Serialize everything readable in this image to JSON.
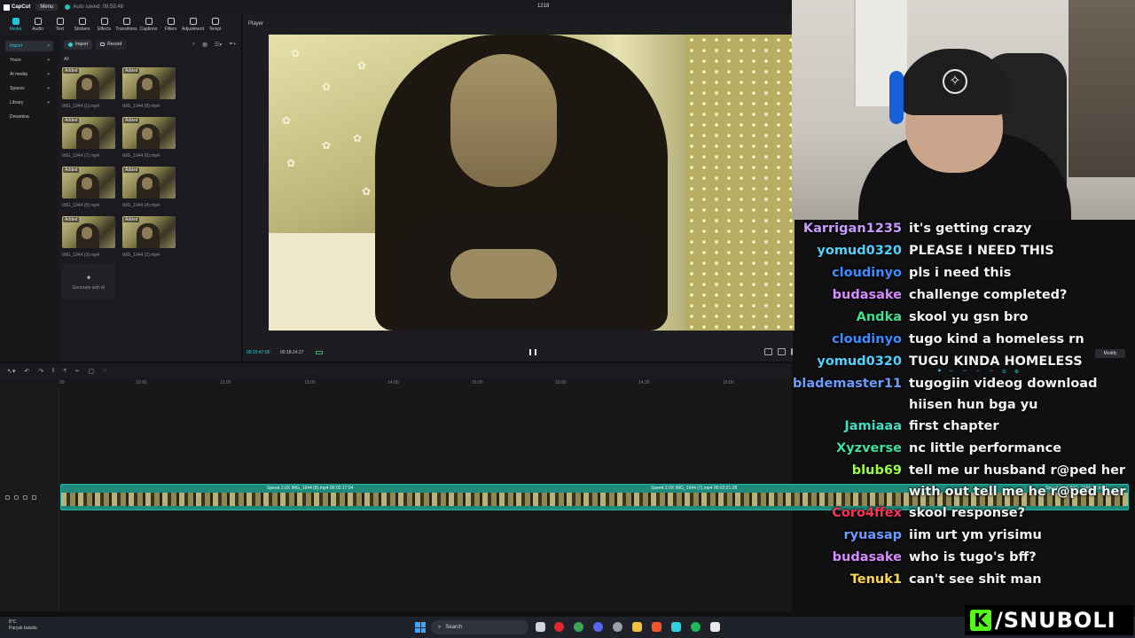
{
  "titlebar": {
    "app_name": "CapCut",
    "menu_label": "Menu",
    "autosave": "Auto saved: 08:55:48",
    "project_name": "1218"
  },
  "toolbar": {
    "tabs": [
      {
        "label": "Media",
        "icon": "media-icon"
      },
      {
        "label": "Audio",
        "icon": "audio-icon"
      },
      {
        "label": "Text",
        "icon": "text-icon"
      },
      {
        "label": "Stickers",
        "icon": "stickers-icon"
      },
      {
        "label": "Effects",
        "icon": "effects-icon"
      },
      {
        "label": "Transitions",
        "icon": "transitions-icon"
      },
      {
        "label": "Captions",
        "icon": "captions-icon"
      },
      {
        "label": "Filters",
        "icon": "filters-icon"
      },
      {
        "label": "Adjustment",
        "icon": "adjustment-icon"
      },
      {
        "label": "Templ",
        "icon": "templates-icon"
      }
    ]
  },
  "sidebar": {
    "items": [
      {
        "label": "Import",
        "active": true
      },
      {
        "label": "Yours"
      },
      {
        "label": "AI media"
      },
      {
        "label": "Spaces"
      },
      {
        "label": "Library"
      },
      {
        "label": "Dreamina"
      }
    ]
  },
  "media": {
    "import_label": "Import",
    "record_label": "Record",
    "filter_label": "All",
    "items": [
      {
        "badge": "Added",
        "name": "IMG_1944 (1).mp4"
      },
      {
        "badge": "Added",
        "name": "IMG_1944 (8).mp4"
      },
      {
        "badge": "Added",
        "name": "IMG_1944 (7).mp4"
      },
      {
        "badge": "Added",
        "name": "IMG_1944 (6).mp4"
      },
      {
        "badge": "Added",
        "name": "IMG_1944 (5).mp4"
      },
      {
        "badge": "Added",
        "name": "IMG_1944 (4).mp4"
      },
      {
        "badge": "Added",
        "name": "IMG_1944 (3).mp4"
      },
      {
        "badge": "Added",
        "name": "IMG_1944 (2).mp4"
      }
    ],
    "generate_label": "Generate with AI"
  },
  "player": {
    "title": "Player",
    "current_time": "00:15:47:00",
    "duration": "00:18:24:27"
  },
  "timeline": {
    "ruler": [
      "00",
      "10:00",
      "12:00",
      "13:00",
      "14:00",
      "15:00",
      "16:00",
      "14:30",
      "15:00"
    ],
    "clips": [
      {
        "label": "Speed 2.0X  IMG_1944 (8).mp4  00:02:17:04"
      },
      {
        "label": "Speed 2.0X  IMG_1944 (7).mp4  00:02:21:28"
      },
      {
        "label": "Speed 2.0X  IMG_1944 (6).mp4"
      }
    ],
    "modify_label": "Modify"
  },
  "chat": {
    "messages": [
      {
        "user": "Karrigan1235",
        "color": "#c99bff",
        "text": "it's getting crazy"
      },
      {
        "user": "yomud0320",
        "color": "#4fd3ff",
        "text": "PLEASE I NEED THIS"
      },
      {
        "user": "cloudinyo",
        "color": "#3a8cff",
        "text": "pls i need this"
      },
      {
        "user": "budasake",
        "color": "#d98cff",
        "text": "challenge completed?"
      },
      {
        "user": "Andka",
        "color": "#3fe08f",
        "text": "skool yu gsn bro"
      },
      {
        "user": "cloudinyo",
        "color": "#3a8cff",
        "text": "tugo kind a homeless rn"
      },
      {
        "user": "yomud0320",
        "color": "#4fd3ff",
        "text": "TUGU KINDA HOMELESS"
      },
      {
        "user": "blademaster11",
        "color": "#6b9dff",
        "text": "tugogiin videog download hiisen hun bga yu"
      },
      {
        "user": "Jamiaaa",
        "color": "#3fe0c0",
        "text": "first chapter"
      },
      {
        "user": "Xyzverse",
        "color": "#3fe09f",
        "text": "nc little performance"
      },
      {
        "user": "blub69",
        "color": "#9dff3f",
        "text": "tell me ur husband r@ped her with out tell me he r@ped her"
      },
      {
        "user": "Coro4ffex",
        "color": "#ff3355",
        "text": "skool response?"
      },
      {
        "user": "ryuasap",
        "color": "#6b9dff",
        "text": "iim urt ym yrisimu"
      },
      {
        "user": "budasake",
        "color": "#d98cff",
        "text": "who is tugo's bff?"
      },
      {
        "user": "Tenuk1",
        "color": "#ffd84a",
        "text": "can't see shit man"
      }
    ]
  },
  "taskbar": {
    "weather_temp": "8°C",
    "weather_desc": "Parçalı bulutlu",
    "search_placeholder": "Search"
  },
  "brand": {
    "logo_letter": "K",
    "name": "/SNUBOLI",
    "color": "#53fc18"
  }
}
